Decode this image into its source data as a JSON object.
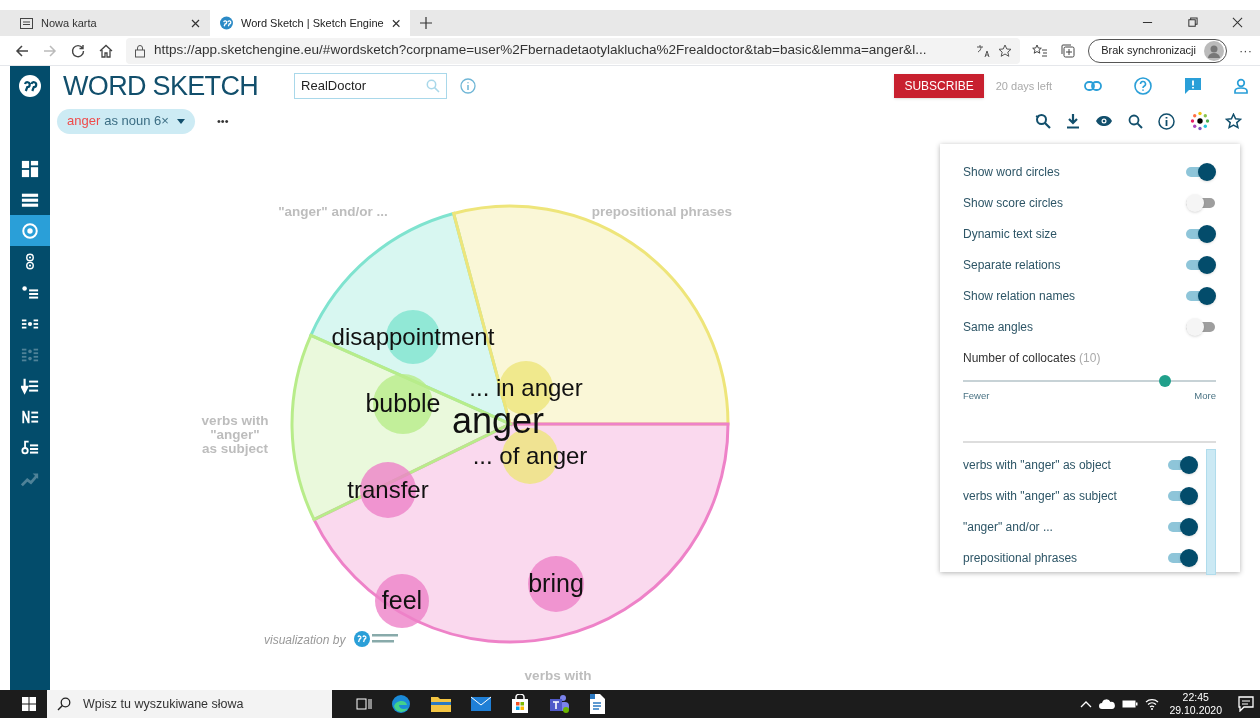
{
  "browser": {
    "tabs": [
      {
        "title": "Nowa karta",
        "selected": false
      },
      {
        "title": "Word Sketch | Sketch Engine",
        "selected": true
      }
    ],
    "url": "https://app.sketchengine.eu/#wordsketch?corpname=user%2Fbernadetaotylaklucha%2Frealdoctor&tab=basic&lemma=anger&l...",
    "sync_button": "Brak synchronizacji",
    "more": "···"
  },
  "sidebar": {
    "items": [
      {
        "selected": false,
        "disabled": false
      },
      {
        "selected": false,
        "disabled": false
      },
      {
        "selected": true,
        "disabled": false
      },
      {
        "selected": false,
        "disabled": false
      },
      {
        "selected": false,
        "disabled": false
      },
      {
        "selected": false,
        "disabled": false
      },
      {
        "selected": false,
        "disabled": true
      },
      {
        "selected": false,
        "disabled": false
      },
      {
        "selected": false,
        "disabled": false
      },
      {
        "selected": false,
        "disabled": false
      },
      {
        "selected": false,
        "disabled": true
      }
    ]
  },
  "header": {
    "title": "WORD SKETCH",
    "corpus_field": "RealDoctor",
    "subscribe": "SUBSCRIBE",
    "trial": "20 days left",
    "lemma_chip": {
      "lemma": "anger",
      "rest": "as noun 6×"
    },
    "more": "•••"
  },
  "visualization": {
    "center_word": "anger",
    "credit": "visualization by",
    "relations": [
      {
        "label_lines": [
          "\"anger\" and/or ..."
        ],
        "color": "#7fe3cf",
        "words": [
          "disappointment"
        ]
      },
      {
        "label_lines": [
          "prepositional phrases"
        ],
        "color": "#eee57a",
        "words": [
          "... in anger",
          "... of anger"
        ]
      },
      {
        "label_lines": [
          "verbs with"
        ],
        "color": "#ee82c8",
        "words": [
          "transfer",
          "bring",
          "feel"
        ]
      },
      {
        "label_lines": [
          "verbs with",
          "\"anger\"",
          "as subject"
        ],
        "color": "#b8ec8a",
        "words": [
          "bubble"
        ]
      }
    ]
  },
  "settings": {
    "toggles": [
      {
        "label": "Show word circles",
        "on": true
      },
      {
        "label": "Show score circles",
        "on": false
      },
      {
        "label": "Dynamic text size",
        "on": true
      },
      {
        "label": "Separate relations",
        "on": true
      },
      {
        "label": "Show relation names",
        "on": true
      },
      {
        "label": "Same angles",
        "on": false
      }
    ],
    "collocates": {
      "label": "Number of collocates",
      "count": "(10)",
      "level": 0.8,
      "min_label": "Fewer",
      "max_label": "More"
    },
    "relations": [
      {
        "label": "verbs with \"anger\" as object",
        "on": true
      },
      {
        "label": "verbs with \"anger\" as subject",
        "on": true
      },
      {
        "label": "\"anger\" and/or ...",
        "on": true
      },
      {
        "label": "prepositional phrases",
        "on": true
      }
    ]
  },
  "taskbar": {
    "search_placeholder": "Wpisz tu wyszukiwane słowa",
    "time": "22:45",
    "date": "29.10.2020"
  }
}
